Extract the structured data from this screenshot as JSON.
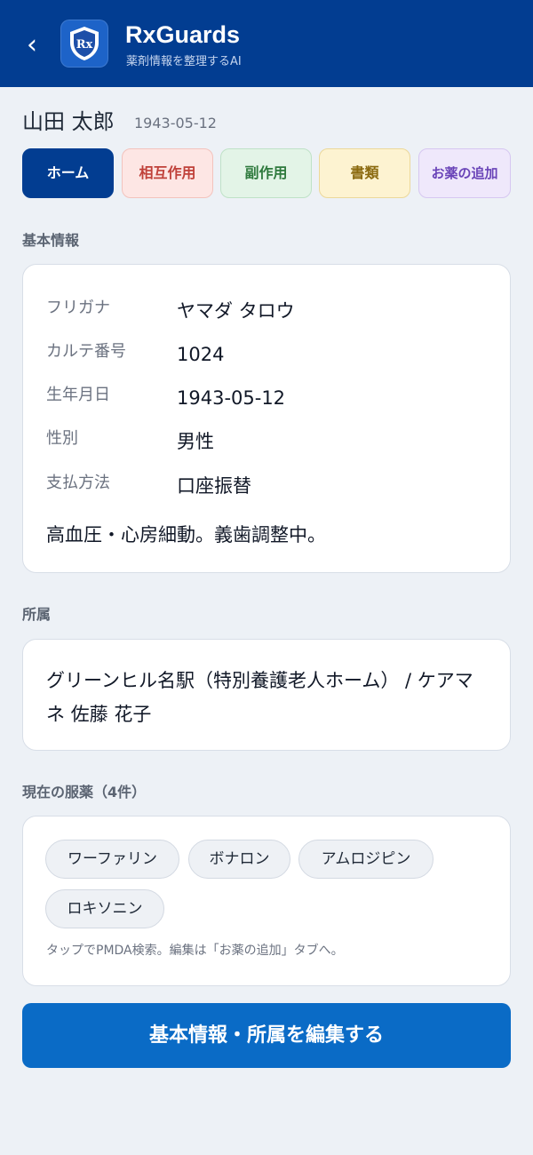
{
  "header": {
    "back_icon": "chevron-left-icon",
    "logo_text": "Rx",
    "title": "RxGuards",
    "subtitle": "薬剤情報を整理するAI"
  },
  "patient": {
    "name": "山田 太郎",
    "dob": "1943-05-12"
  },
  "tabs": [
    {
      "label": "ホーム"
    },
    {
      "label": "相互作用"
    },
    {
      "label": "副作用"
    },
    {
      "label": "書類"
    },
    {
      "label": "お薬の追加"
    }
  ],
  "basic_info": {
    "section_label": "基本情報",
    "rows": [
      {
        "label": "フリガナ",
        "value": "ヤマダ タロウ"
      },
      {
        "label": "カルテ番号",
        "value": "1024"
      },
      {
        "label": "生年月日",
        "value": "1943-05-12"
      },
      {
        "label": "性別",
        "value": "男性"
      },
      {
        "label": "支払方法",
        "value": "口座振替"
      }
    ],
    "note": "高血圧・心房細動。義歯調整中。"
  },
  "affiliation": {
    "section_label": "所属",
    "text": "グリーンヒル名駅（特別養護老人ホーム） / ケアマネ 佐藤 花子"
  },
  "medications": {
    "section_label": "現在の服薬（4件）",
    "items": [
      "ワーファリン",
      "ボナロン",
      "アムロジピン",
      "ロキソニン"
    ],
    "hint": "タップでPMDA検索。編集は「お薬の追加」タブへ。"
  },
  "actions": {
    "edit_label": "基本情報・所属を編集する"
  },
  "colors": {
    "header_bg": "#023d91",
    "primary_button": "#0a6bc6",
    "page_bg": "#edf1f6"
  }
}
